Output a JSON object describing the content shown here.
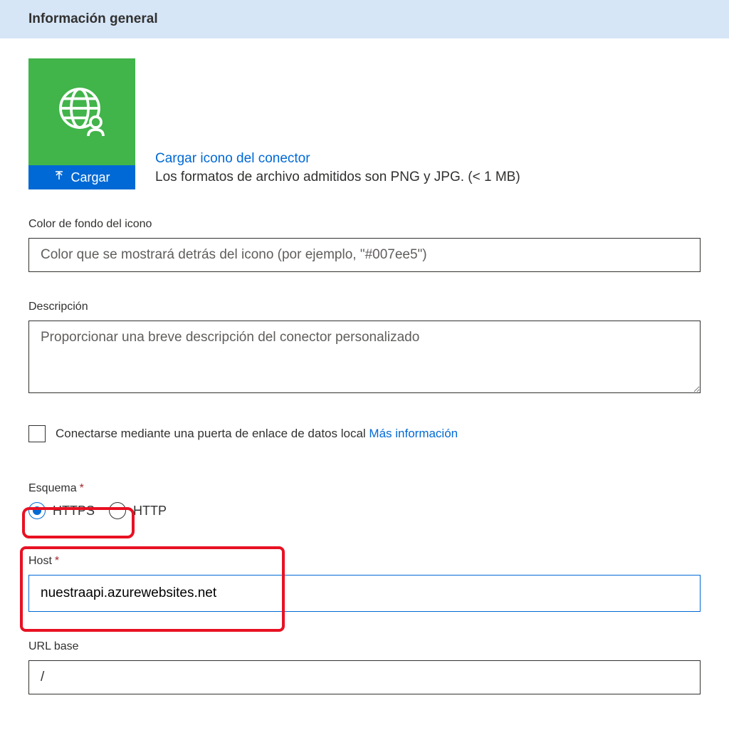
{
  "header": {
    "title": "Información general"
  },
  "iconSection": {
    "uploadButton": "Cargar",
    "linkText": "Cargar icono del conector",
    "supportText": "Los formatos de archivo admitidos son PNG y JPG. (< 1 MB)"
  },
  "fields": {
    "bgColor": {
      "label": "Color de fondo del icono",
      "placeholder": "Color que se mostrará detrás del icono (por ejemplo, \"#007ee5\")"
    },
    "description": {
      "label": "Descripción",
      "placeholder": "Proporcionar una breve descripción del conector personalizado"
    },
    "gateway": {
      "label": "Conectarse mediante una puerta de enlace de datos local ",
      "link": "Más información"
    },
    "schema": {
      "label": "Esquema",
      "options": {
        "https": "HTTPS",
        "http": "HTTP"
      }
    },
    "host": {
      "label": "Host",
      "value": "nuestraapi.azurewebsites.net"
    },
    "urlBase": {
      "label": "URL base",
      "value": "/"
    }
  }
}
